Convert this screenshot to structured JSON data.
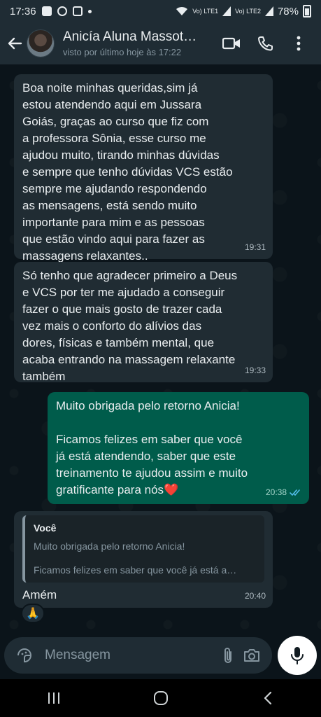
{
  "status_bar": {
    "time": "17:36",
    "network1": "Vo) LTE1",
    "network2": "Vo) LTE2",
    "battery": "78%"
  },
  "header": {
    "contact_name": "Anicía Aluna Massot…",
    "contact_status": "visto por último hoje às 17:22",
    "icons": [
      "back-arrow-icon",
      "video-call-icon",
      "phone-icon",
      "more-icon"
    ]
  },
  "messages": [
    {
      "direction": "in",
      "text": "Boa noite minhas queridas,sim já\nestou atendendo aqui em Jussara\nGoiás, graças ao curso que fiz com\na professora Sônia, esse curso me\najudou muito, tirando minhas dúvidas\ne sempre que tenho dúvidas VCS estão\nsempre me ajudando respondendo\nas mensagens, está sendo muito\nimportante para mim e as pessoas\nque estão vindo aqui para fazer as\nmassagens relaxantes..",
      "time": "19:31"
    },
    {
      "direction": "in",
      "text": "Só tenho que agradecer primeiro a Deus\ne VCS por ter me ajudado a conseguir\nfazer o que mais gosto de trazer cada\nvez mais o conforto do alívios das\ndores, físicas e também mental, que\nacaba entrando na massagem relaxante\ntambém",
      "time": "19:33"
    },
    {
      "direction": "out",
      "text": "Muito obrigada pelo retorno Anicia!\n\nFicamos felizes em saber que você\njá está atendendo, saber que este\ntreinamento te ajudou assim e muito\ngratificante para nós❤️",
      "time": "20:38",
      "status": "read"
    },
    {
      "direction": "in",
      "quote_author": "Você",
      "quote_line1": "Muito obrigada pelo retorno Anicia!",
      "quote_line2": "Ficamos felizes em saber que você já está a…",
      "text": "Amém",
      "time": "20:40",
      "reaction": "🙏"
    }
  ],
  "composer": {
    "placeholder": "Mensagem",
    "icons": [
      "sticker-icon",
      "attach-icon",
      "camera-icon",
      "mic-icon"
    ]
  },
  "colors": {
    "incoming_bubble": "#202c33",
    "outgoing_bubble": "#005c4b",
    "chat_background": "#0b141a",
    "header": "#1f2c34",
    "read_ticks": "#53bdeb"
  }
}
